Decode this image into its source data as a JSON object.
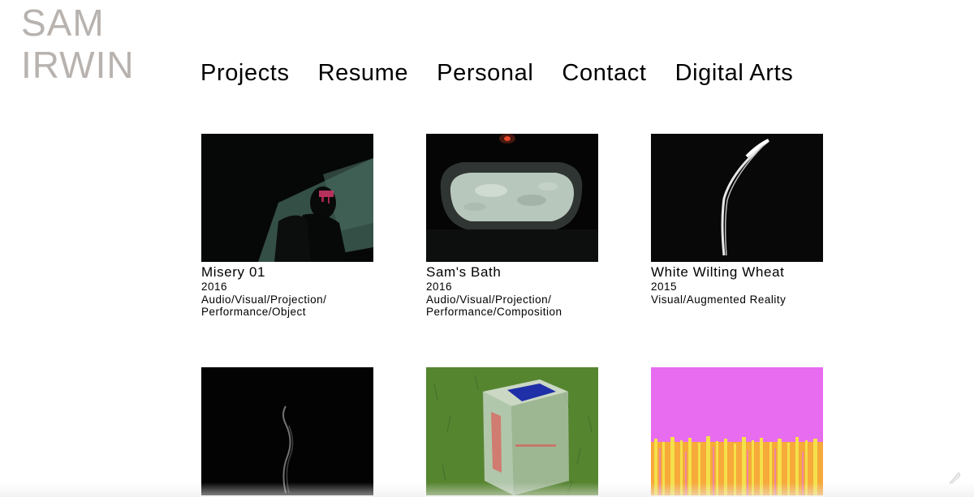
{
  "site": {
    "logo_line1": "SAM",
    "logo_line2": "IRWIN"
  },
  "nav": {
    "items": [
      "Projects",
      "Resume",
      "Personal",
      "Contact",
      "Digital Arts"
    ]
  },
  "projects": [
    {
      "title": "Misery 01",
      "year": "2016",
      "category_line1": "Audio/Visual/Projection/",
      "category_line2": "Performance/Object"
    },
    {
      "title": "Sam's Bath",
      "year": "2016",
      "category_line1": "Audio/Visual/Projection/",
      "category_line2": "Performance/Composition"
    },
    {
      "title": "White Wilting Wheat",
      "year": "2015",
      "category_line1": "Visual/Augmented Reality",
      "category_line2": ""
    },
    {
      "title": "",
      "year": "",
      "category_line1": "",
      "category_line2": ""
    },
    {
      "title": "",
      "year": "",
      "category_line1": "",
      "category_line2": ""
    },
    {
      "title": "",
      "year": "",
      "category_line1": "",
      "category_line2": ""
    }
  ],
  "colors": {
    "logo": "#b8b3af",
    "text": "#000000",
    "background": "#ffffff"
  },
  "icons": {
    "corner": "feather-icon"
  }
}
